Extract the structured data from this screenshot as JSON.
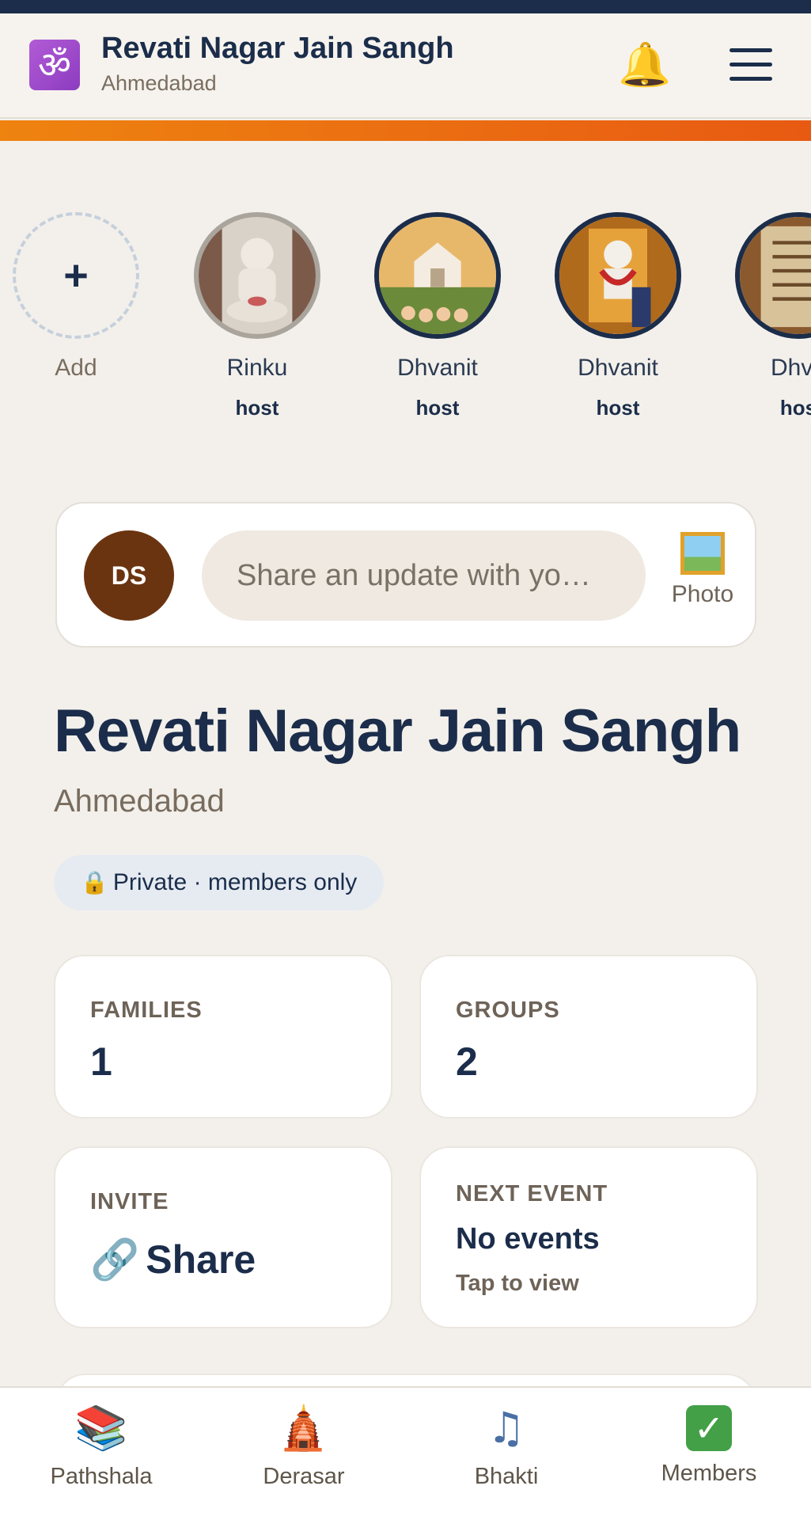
{
  "header": {
    "app_icon": "om-icon",
    "title": "Revati Nagar Jain Sangh",
    "subtitle": "Ahmedabad",
    "notification_icon": "bell-icon",
    "menu_icon": "hamburger-menu-icon"
  },
  "stories": {
    "add_label": "Add",
    "items": [
      {
        "name": "Rinku",
        "role": "host"
      },
      {
        "name": "Dhvanit",
        "role": "host"
      },
      {
        "name": "Dhvanit",
        "role": "host"
      },
      {
        "name": "Dhva",
        "role": "hos"
      }
    ]
  },
  "composer": {
    "avatar_initials": "DS",
    "placeholder": "Share an update with yo…",
    "photo_label": "Photo"
  },
  "sangh": {
    "title": "Revati Nagar Jain Sangh",
    "city": "Ahmedabad",
    "privacy": "Private · members only"
  },
  "stats": {
    "families": {
      "label": "FAMILIES",
      "value": "1"
    },
    "groups": {
      "label": "GROUPS",
      "value": "2"
    },
    "invite": {
      "label": "INVITE",
      "value": "Share"
    },
    "next_event": {
      "label": "NEXT EVENT",
      "value": "No events",
      "sub": "Tap to view"
    }
  },
  "bottom_nav": [
    {
      "label": "Pathshala",
      "icon": "books-icon"
    },
    {
      "label": "Derasar",
      "icon": "temple-icon"
    },
    {
      "label": "Bhakti",
      "icon": "music-note-icon"
    },
    {
      "label": "Members",
      "icon": "check-mark-icon"
    }
  ],
  "colors": {
    "navy": "#1b2d4a",
    "accent_orange": "#ee8310",
    "background": "#f3f0eb",
    "avatar_brown": "#6b3410"
  }
}
